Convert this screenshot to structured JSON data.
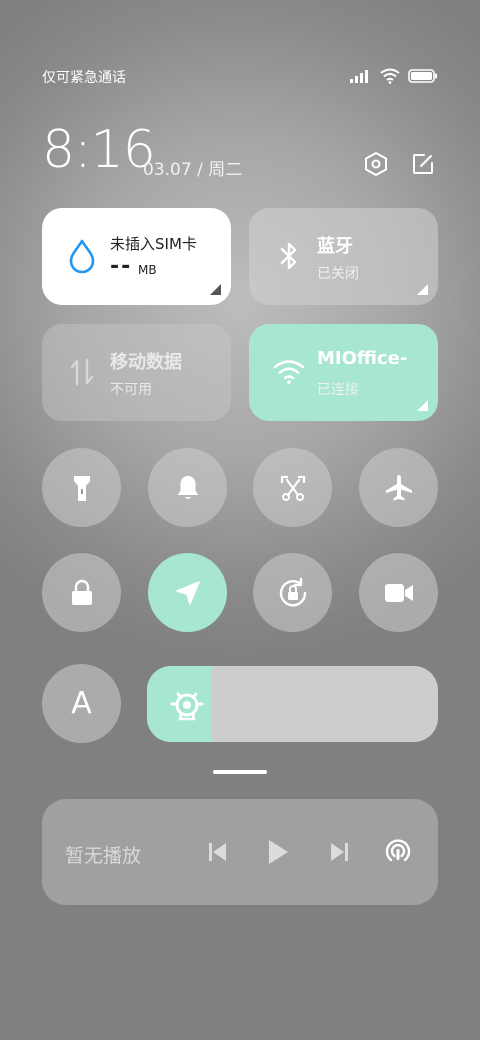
{
  "status_bar": {
    "carrier_text": "仅可紧急通话",
    "battery_level": 1.0
  },
  "header": {
    "time": "8:16",
    "date": "03.07 / 周二"
  },
  "tiles": {
    "sim": {
      "title": "未插入SIM卡",
      "value": "--",
      "unit": "MB"
    },
    "bluetooth": {
      "title": "蓝牙",
      "status": "已关闭"
    },
    "mobile_data": {
      "title": "移动数据",
      "status": "不可用"
    },
    "wifi": {
      "title": "MIOffice-",
      "status": "已连接"
    }
  },
  "toggles": [
    {
      "name": "flashlight",
      "on": false
    },
    {
      "name": "bell",
      "on": false
    },
    {
      "name": "screenshot",
      "on": false
    },
    {
      "name": "airplane",
      "on": false
    },
    {
      "name": "lock",
      "on": false
    },
    {
      "name": "location",
      "on": true
    },
    {
      "name": "rotation-lock",
      "on": false
    },
    {
      "name": "screen-record",
      "on": false
    },
    {
      "name": "auto-brightness",
      "label": "A",
      "on": false
    }
  ],
  "brightness": {
    "level": 0.22
  },
  "media": {
    "status_text": "暂无播放"
  },
  "colors": {
    "accent": "#a7e6d1",
    "sim_tile": "#ffffff",
    "water_icon": "#2196f3"
  }
}
